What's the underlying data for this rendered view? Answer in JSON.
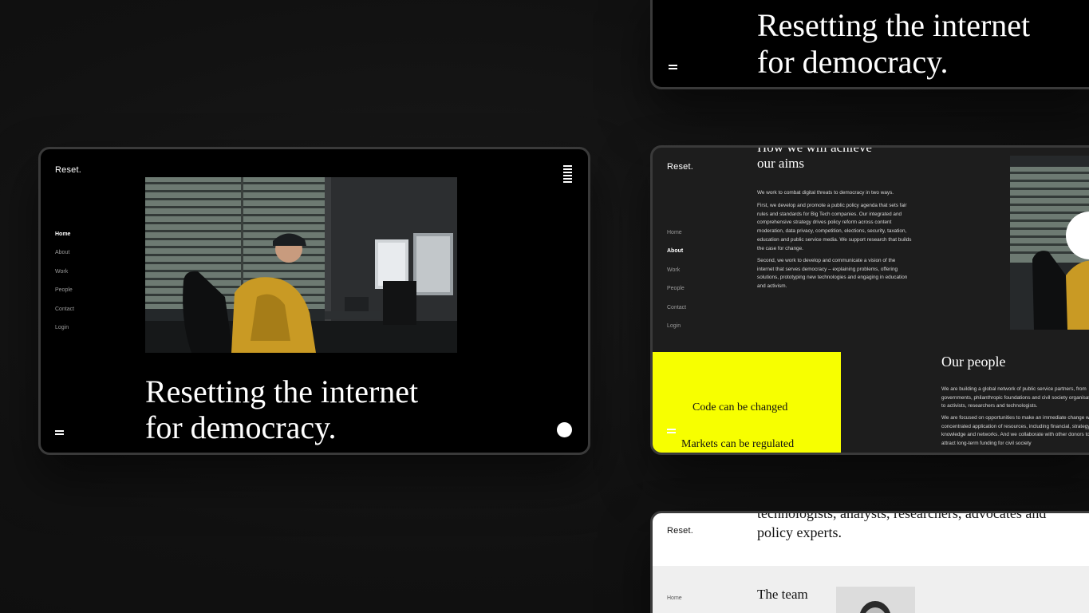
{
  "main": {
    "brand": "Reset.",
    "nav": [
      "Home",
      "About",
      "Work",
      "People",
      "Contact",
      "Login"
    ],
    "active_nav": "Home",
    "hero_line1": "Resetting the internet",
    "hero_line2": "for democracy."
  },
  "top": {
    "hero_line1": "Resetting the internet",
    "hero_line2": "for democracy."
  },
  "about": {
    "brand": "Reset.",
    "nav": [
      "Home",
      "About",
      "Work",
      "People",
      "Contact",
      "Login"
    ],
    "active_nav": "About",
    "title_line1": "How we will achieve",
    "title_line2": "our aims",
    "p1": "We work to combat digital threats to democracy in two ways.",
    "p2": "First, we develop and promote a public policy agenda that sets fair rules and standards for Big Tech companies. Our integrated and comprehensive strategy drives policy reform across content moderation, data privacy, competition, elections, security, taxation, education and public service media. We support research that builds the case for change.",
    "p3": "Second, we work to develop and communicate a vision of the internet that serves democracy – explaining problems, offering solutions, prototyping new technologies and engaging in education and activism.",
    "yellow_line1": "Code can be changed",
    "yellow_line2": "Markets can be regulated",
    "people_title": "Our people",
    "people_p1": "We are building a global network of public service partners, from governments, philanthropic foundations and civil society organisations to activists, researchers and technologists.",
    "people_p2": "We are focused on opportunities to make an immediate change with a concentrated application of resources, including financial, strategy, knowledge and networks. And we collaborate with other donors to attract long-term funding for civil society"
  },
  "people_page": {
    "brand": "Reset.",
    "intro_line1": "technologists, analysts, researchers, advocates and",
    "intro_line2": "policy experts.",
    "nav_home": "Home",
    "team_title": "The team"
  },
  "colors": {
    "accent_yellow": "#f7ff00",
    "background": "#111111",
    "device_black": "#000000"
  }
}
